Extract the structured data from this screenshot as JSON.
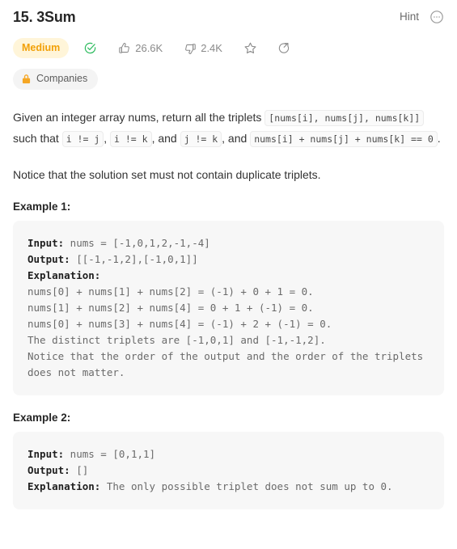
{
  "header": {
    "title": "15. 3Sum",
    "hint_label": "Hint",
    "more_icon": "ellipsis-circle-icon"
  },
  "meta": {
    "difficulty": "Medium",
    "solved_icon": "check-circle-icon",
    "like_icon": "thumbs-up-icon",
    "likes": "26.6K",
    "dislike_icon": "thumbs-down-icon",
    "dislikes": "2.4K",
    "star_icon": "star-outline-icon",
    "share_icon": "share-circle-icon",
    "colors": {
      "difficulty_text": "#f2a007",
      "difficulty_bg": "#fff5d9",
      "solved_green": "#2cbb5d",
      "lock_orange": "#f5a623",
      "muted_text": "#8a8a8a"
    }
  },
  "companies": {
    "lock_icon": "lock-icon",
    "label": "Companies"
  },
  "description": {
    "para1_a": "Given an integer array nums, return all the triplets ",
    "para1_code1": "[nums[i], nums[j], nums[k]]",
    "para1_b": " such that ",
    "para1_code2": "i != j",
    "para1_c": ", ",
    "para1_code3": "i != k",
    "para1_d": ", and ",
    "para1_code4": "j != k",
    "para1_e": ", and ",
    "para1_code5": "nums[i] + nums[j] + nums[k] == 0",
    "para1_f": ".",
    "para2": "Notice that the solution set must not contain duplicate triplets."
  },
  "examples": [
    {
      "title": "Example 1:",
      "input_label": "Input:",
      "input_value": " nums = [-1,0,1,2,-1,-4]",
      "output_label": "Output:",
      "output_value": " [[-1,-1,2],[-1,0,1]]",
      "explanation_label": "Explanation:",
      "explanation_value": "\nnums[0] + nums[1] + nums[2] = (-1) + 0 + 1 = 0.\nnums[1] + nums[2] + nums[4] = 0 + 1 + (-1) = 0.\nnums[0] + nums[3] + nums[4] = (-1) + 2 + (-1) = 0.\nThe distinct triplets are [-1,0,1] and [-1,-1,2].\nNotice that the order of the output and the order of the triplets does not matter."
    },
    {
      "title": "Example 2:",
      "input_label": "Input:",
      "input_value": " nums = [0,1,1]",
      "output_label": "Output:",
      "output_value": " []",
      "explanation_label": "Explanation:",
      "explanation_value": " The only possible triplet does not sum up to 0."
    }
  ]
}
